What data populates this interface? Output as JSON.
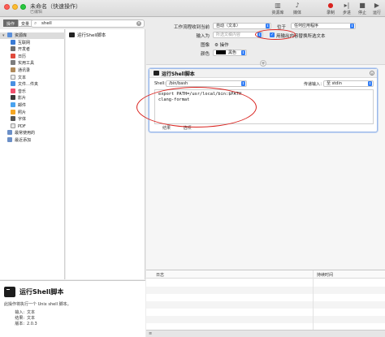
{
  "window": {
    "title": "未命名（快速操作）",
    "subtitle": "已编辑"
  },
  "toolbar": [
    {
      "label": "资源库",
      "icon": "library-icon"
    },
    {
      "label": "媒体",
      "icon": "media-icon"
    },
    {
      "label": "录制",
      "icon": "record-icon"
    },
    {
      "label": "步进",
      "icon": "step-icon"
    },
    {
      "label": "停止",
      "icon": "stop-icon"
    },
    {
      "label": "运行",
      "icon": "run-icon"
    }
  ],
  "sidebar": {
    "tabs": [
      {
        "label": "操作",
        "active": true
      },
      {
        "label": "变量",
        "active": false
      }
    ],
    "search_value": "shell",
    "library": [
      {
        "label": "资源库",
        "level": 0,
        "selected": true,
        "color": "#5b8fd9"
      },
      {
        "label": "互联网",
        "level": 1,
        "color": "#3a7bd5"
      },
      {
        "label": "开发者",
        "level": 1,
        "color": "#6e6e6e"
      },
      {
        "label": "日历",
        "level": 1,
        "color": "#e04b3c"
      },
      {
        "label": "实用工具",
        "level": 1,
        "color": "#7d7d7d"
      },
      {
        "label": "通讯录",
        "level": 1,
        "color": "#b08a5a"
      },
      {
        "label": "文本",
        "level": 1,
        "color": "#eeeeee"
      },
      {
        "label": "文件…件夹",
        "level": 1,
        "color": "#4a90e2"
      },
      {
        "label": "音乐",
        "level": 1,
        "color": "#f0506e"
      },
      {
        "label": "影片",
        "level": 1,
        "color": "#3a3a3a"
      },
      {
        "label": "邮件",
        "level": 1,
        "color": "#4aa3ef"
      },
      {
        "label": "照片",
        "level": 1,
        "color": "#f5a623"
      },
      {
        "label": "字体",
        "level": 1,
        "color": "#555555"
      },
      {
        "label": "PDF",
        "level": 1,
        "color": "#e8e8e8"
      },
      {
        "label": "最常使用的",
        "level": 0,
        "color": "#6b8fc7"
      },
      {
        "label": "最近添加",
        "level": 0,
        "color": "#6b8fc7"
      }
    ],
    "actions": [
      {
        "label": "运行Shell脚本"
      }
    ]
  },
  "description": {
    "title": "运行Shell脚本",
    "text": "此操作将执行一个 Unix shell 脚本。",
    "rows": [
      {
        "key": "输入:",
        "value": "文本"
      },
      {
        "key": "结果:",
        "value": "文本"
      },
      {
        "key": "版本:",
        "value": "2.0.3"
      }
    ]
  },
  "workflow": {
    "receives_label": "工作流程收到当前",
    "receives_value": "自动（文本）",
    "in_label": "位于",
    "in_value": "任何应用程序",
    "input_label": "输入为",
    "input_placeholder": "所选文稿内容",
    "replace_label": "用输出内容替换所选文本",
    "image_label": "图像",
    "image_value": "⚙ 操作",
    "color_label": "颜色",
    "color_value": "黑色",
    "add_symbol": "+"
  },
  "card": {
    "title": "运行Shell脚本",
    "shell_label": "Shell:",
    "shell_value": "/bin/bash",
    "pass_label": "传递输入：",
    "pass_value": "至 stdin",
    "script_lines": [
      "export PATH=/usr/local/bin:$PATH",
      "clang-format"
    ],
    "footer": [
      "结果",
      "选项"
    ]
  },
  "log": {
    "col_log": "日志",
    "col_duration": "持续时间"
  },
  "colors": {
    "accent": "#2f7cf6",
    "annotation": "#d9231f"
  }
}
